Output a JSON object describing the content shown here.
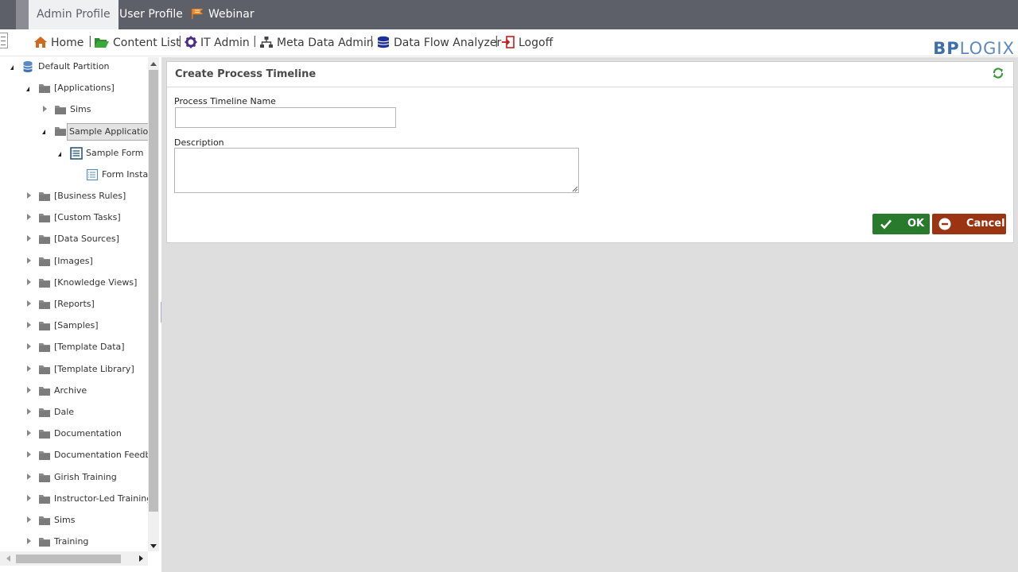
{
  "tabs": [
    {
      "label": "Admin Profile",
      "active": true
    },
    {
      "label": "User Profile",
      "active": false
    },
    {
      "label": "Webinar",
      "active": false
    }
  ],
  "nav": {
    "items": [
      {
        "label": "Home",
        "icon": "home-icon"
      },
      {
        "label": "Content List",
        "icon": "folder-open-icon"
      },
      {
        "label": "IT Admin",
        "icon": "gear-icon"
      },
      {
        "label": "Meta Data Admin",
        "icon": "sitemap-icon"
      },
      {
        "label": "Data Flow Analyzer",
        "icon": "database-icon"
      },
      {
        "label": "Logoff",
        "icon": "logoff-icon"
      }
    ],
    "separator": "|",
    "logo_bp": "BP",
    "logo_logix": "LOGIX"
  },
  "tree": {
    "root": "Default Partition",
    "items": [
      {
        "label": "[Applications]",
        "level": 1,
        "expanded": true
      },
      {
        "label": "Sims",
        "level": 2,
        "expanded": false
      },
      {
        "label": "Sample Application",
        "level": 2,
        "expanded": true,
        "selected": true
      },
      {
        "label": "Sample Form",
        "level": 3,
        "expanded": true,
        "type": "form"
      },
      {
        "label": "Form Instance",
        "level": 4,
        "type": "form-instance"
      },
      {
        "label": "[Business Rules]",
        "level": 1
      },
      {
        "label": "[Custom Tasks]",
        "level": 1
      },
      {
        "label": "[Data Sources]",
        "level": 1
      },
      {
        "label": "[Images]",
        "level": 1
      },
      {
        "label": "[Knowledge Views]",
        "level": 1
      },
      {
        "label": "[Reports]",
        "level": 1
      },
      {
        "label": "[Samples]",
        "level": 1
      },
      {
        "label": "[Template Data]",
        "level": 1
      },
      {
        "label": "[Template Library]",
        "level": 1
      },
      {
        "label": "Archive",
        "level": 1
      },
      {
        "label": "Dale",
        "level": 1
      },
      {
        "label": "Documentation",
        "level": 1
      },
      {
        "label": "Documentation Feedback",
        "level": 1
      },
      {
        "label": "Girish Training",
        "level": 1
      },
      {
        "label": "Instructor-Led Training",
        "level": 1
      },
      {
        "label": "Sims",
        "level": 1
      },
      {
        "label": "Training",
        "level": 1
      }
    ]
  },
  "form": {
    "title": "Create Process Timeline",
    "name_label": "Process Timeline Name",
    "name_value": "",
    "description_label": "Description",
    "description_value": "",
    "ok_label": "OK",
    "cancel_label": "Cancel"
  },
  "colors": {
    "topbar": "#5e6069",
    "ok": "#2a7a2e",
    "cancel": "#9b3412",
    "logo": "#3d6fa8"
  }
}
